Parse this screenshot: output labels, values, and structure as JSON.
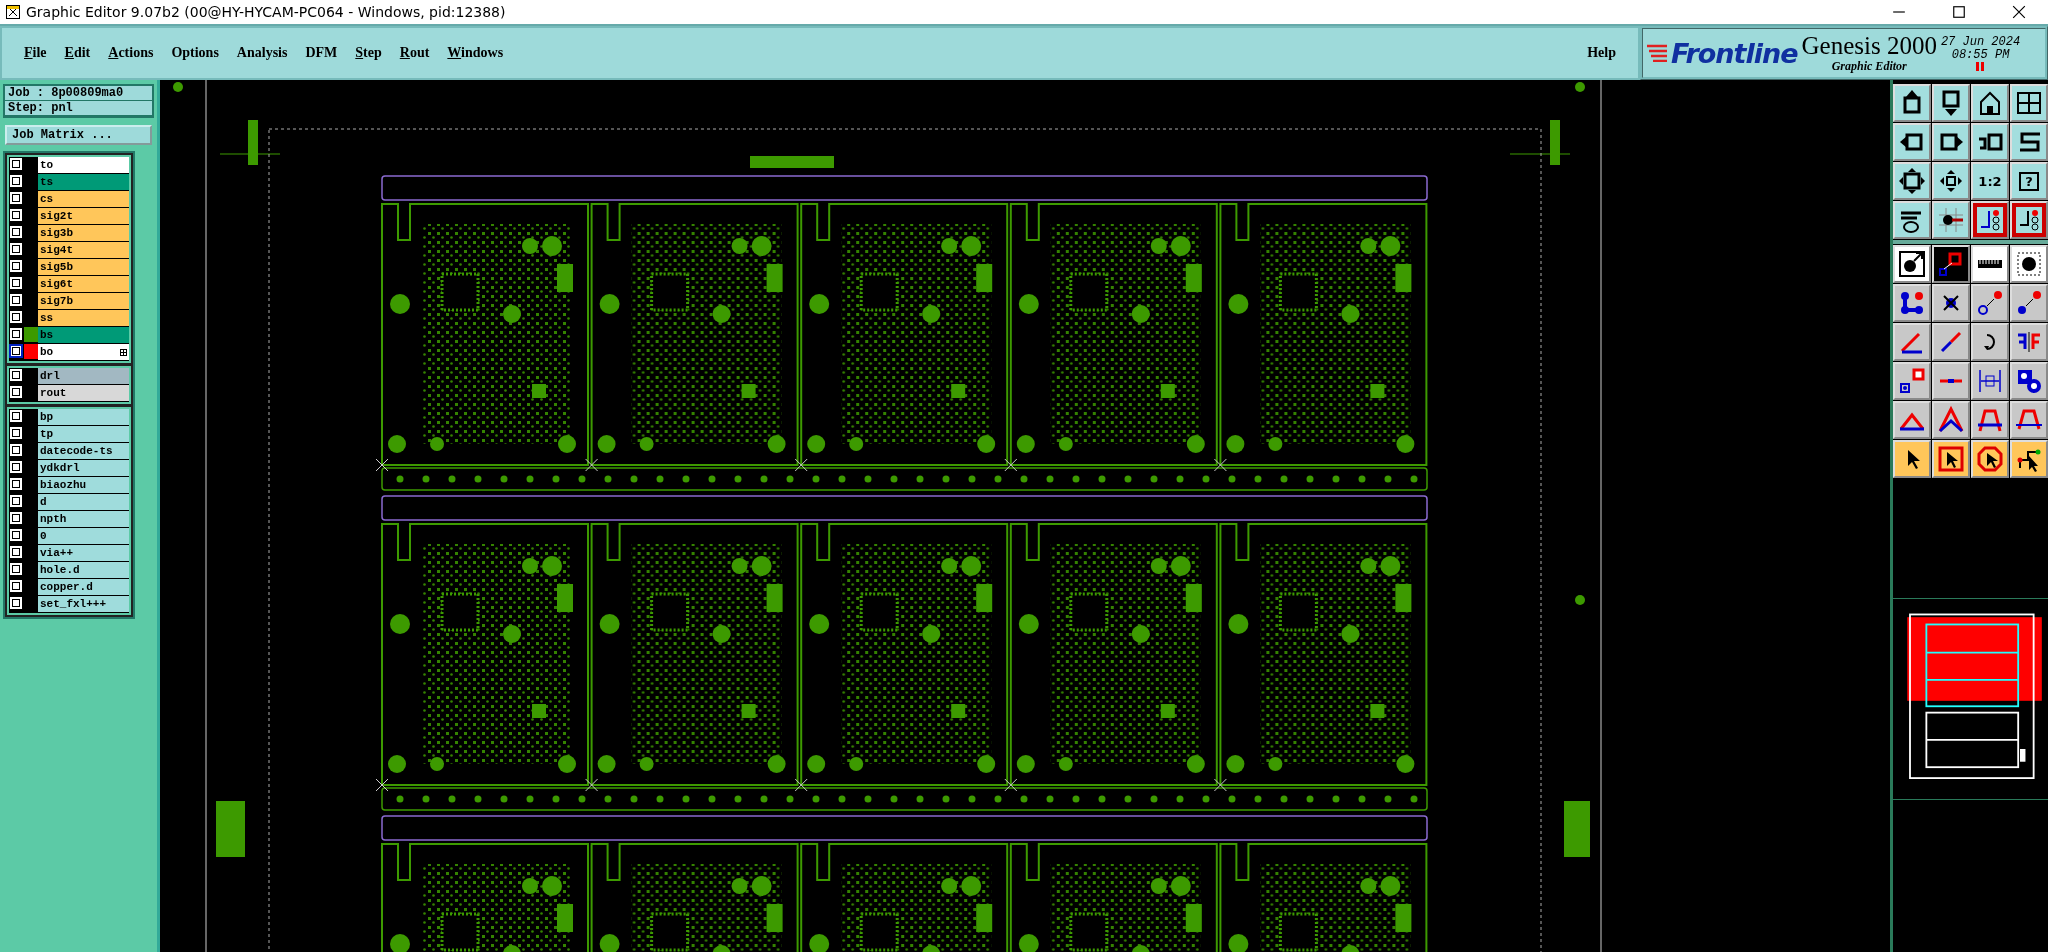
{
  "window": {
    "title": "Graphic Editor 9.07b2 (00@HY-HYCAM-PC064 - Windows, pid:12388)"
  },
  "menu": [
    {
      "label": "File",
      "mnemonic": true
    },
    {
      "label": "Edit",
      "mnemonic": true
    },
    {
      "label": "Actions",
      "mnemonic": true
    },
    {
      "label": "Options",
      "mnemonic": false
    },
    {
      "label": "Analysis",
      "mnemonic": false
    },
    {
      "label": "DFM",
      "mnemonic": false
    },
    {
      "label": "Step",
      "mnemonic": true
    },
    {
      "label": "Rout",
      "mnemonic": true
    },
    {
      "label": "Windows",
      "mnemonic": true
    }
  ],
  "help": "Help",
  "brand": {
    "logo": "Frontline",
    "product": "Genesis 2000",
    "subtitle": "Graphic Editor",
    "date": "27 Jun 2024",
    "time": "08:55 PM"
  },
  "job": {
    "job": "Job : 8p00809ma0",
    "step": "Step: pnl",
    "matrix_button": "Job Matrix ..."
  },
  "layer_groups": [
    [
      {
        "name": "to",
        "kind": "overlay",
        "work": false
      },
      {
        "name": "ts",
        "kind": "mask",
        "work": false
      },
      {
        "name": "cs",
        "kind": "signal",
        "work": false
      },
      {
        "name": "sig2t",
        "kind": "signal",
        "work": false
      },
      {
        "name": "sig3b",
        "kind": "signal",
        "work": false
      },
      {
        "name": "sig4t",
        "kind": "signal",
        "work": false
      },
      {
        "name": "sig5b",
        "kind": "signal",
        "work": false
      },
      {
        "name": "sig6t",
        "kind": "signal",
        "work": false
      },
      {
        "name": "sig7b",
        "kind": "signal",
        "work": false
      },
      {
        "name": "ss",
        "kind": "signal",
        "work": false
      },
      {
        "name": "bs",
        "kind": "mask",
        "work": false,
        "color": "#3d9a00"
      },
      {
        "name": "bo",
        "kind": "overlay",
        "work": true,
        "color": "#ff0000"
      }
    ],
    [
      {
        "name": "drl",
        "kind": "drill",
        "work": false
      },
      {
        "name": "rout",
        "kind": "rout",
        "work": false
      }
    ],
    [
      {
        "name": "bp",
        "kind": "misc",
        "work": false
      },
      {
        "name": "tp",
        "kind": "misc",
        "work": false
      },
      {
        "name": "datecode-ts",
        "kind": "misc",
        "work": false
      },
      {
        "name": "ydkdrl",
        "kind": "misc",
        "work": false
      },
      {
        "name": "biaozhu",
        "kind": "misc",
        "work": false
      },
      {
        "name": "d",
        "kind": "misc",
        "work": false
      },
      {
        "name": "npth",
        "kind": "misc",
        "work": false
      },
      {
        "name": "0",
        "kind": "misc",
        "work": false
      },
      {
        "name": "via++",
        "kind": "misc",
        "work": false
      },
      {
        "name": "hole.d",
        "kind": "misc",
        "work": false
      },
      {
        "name": "copper.d",
        "kind": "misc",
        "work": false
      },
      {
        "name": "set_fxl+++",
        "kind": "misc",
        "work": false
      }
    ]
  ],
  "toolbar": {
    "zoom_ratio": "1:2",
    "help_tool": "?"
  }
}
